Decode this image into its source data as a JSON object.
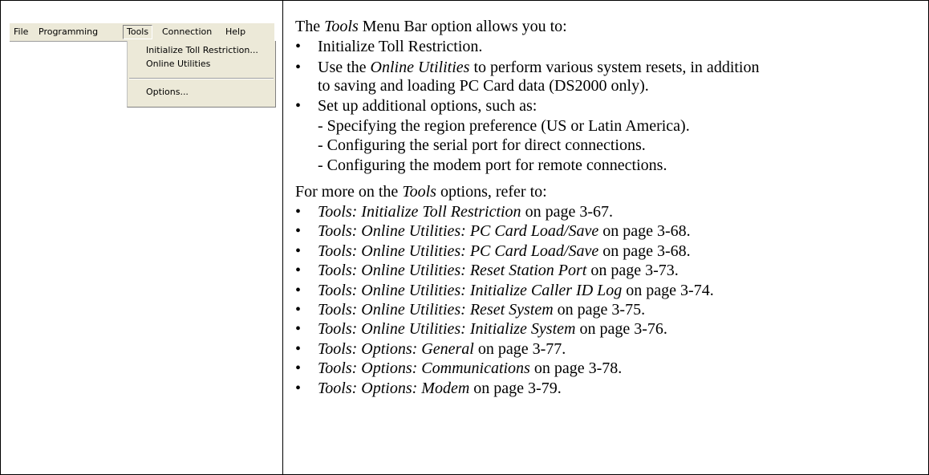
{
  "menu": {
    "menubar": [
      "File",
      "Programming",
      "Tools",
      "Connection",
      "Help"
    ],
    "dropdown_items": [
      "Initialize Toll Restriction...",
      "Online Utilities",
      "Options..."
    ]
  },
  "intro": {
    "italic": "Tools",
    "rest": " Menu Bar option allows you to:",
    "prefix": "The "
  },
  "bullets1": [
    {
      "plain": "Initialize Toll Restriction."
    },
    {
      "pre": "Use the ",
      "italic": "Online Utilities",
      "post": " to perform various system resets, in addition",
      "cont": "to saving and loading PC Card data (DS2000 only)."
    },
    {
      "plain": "Set up additional options, such as:"
    }
  ],
  "sub_items": [
    "- Specifying the region preference (US or Latin America).",
    "- Configuring the serial port for direct connections.",
    "- Configuring the modem port for remote connections."
  ],
  "refer": {
    "prefix": "For more on the ",
    "italic": "Tools",
    "rest": " options, refer to:"
  },
  "refs": [
    {
      "italic": "Tools: Initialize Toll Restriction",
      "page": " on page 3-67."
    },
    {
      "italic": "Tools: Online Utilities: PC Card Load/Save",
      "page": " on page 3-68."
    },
    {
      "italic": "Tools: Online Utilities: PC Card Load/Save",
      "page": " on page 3-68."
    },
    {
      "italic": "Tools: Online Utilities: Reset Station Port",
      "page": " on page 3-73."
    },
    {
      "italic": "Tools: Online Utilities: Initialize Caller ID Log",
      "page": " on page 3-74."
    },
    {
      "italic": "Tools: Online Utilities: Reset System",
      "page": " on page 3-75."
    },
    {
      "italic": "Tools: Online Utilities: Initialize System",
      "page": " on page 3-76."
    },
    {
      "italic": "Tools: Options: General",
      "page": " on page 3-77."
    },
    {
      "italic": "Tools: Options: Communications",
      "page": " on page 3-78."
    },
    {
      "italic": "Tools: Options: Modem",
      "page": " on page 3-79."
    }
  ],
  "bullet_char": "•"
}
